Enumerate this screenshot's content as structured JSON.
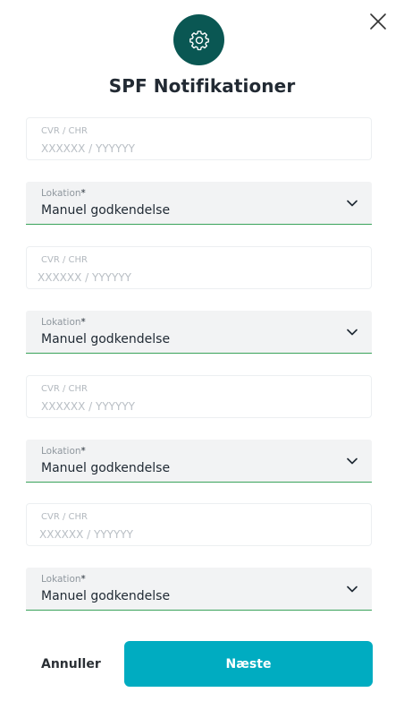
{
  "dialog": {
    "title": "SPF Notifikationer",
    "header_icon": "gear-icon",
    "close_icon": "close-icon"
  },
  "rows": [
    {
      "cvr": {
        "label": "CVR / CHR",
        "placeholder": "XXXXXX / YYYYYY",
        "value": ""
      },
      "location": {
        "label": "Lokation",
        "required_mark": "*",
        "value": "Manuel godkendelse"
      }
    },
    {
      "cvr": {
        "label": "CVR / CHR",
        "placeholder": "XXXXXX / YYYYYY",
        "value": ""
      },
      "location": {
        "label": "Lokation",
        "required_mark": "*",
        "value": "Manuel godkendelse"
      }
    },
    {
      "cvr": {
        "label": "CVR / CHR",
        "placeholder": "XXXXXX / YYYYYY",
        "value": ""
      },
      "location": {
        "label": "Lokation",
        "required_mark": "*",
        "value": "Manuel godkendelse"
      }
    },
    {
      "cvr": {
        "label": "CVR / CHR",
        "placeholder": "XXXXXX / YYYYYY",
        "value": ""
      },
      "location": {
        "label": "Lokation",
        "required_mark": "*",
        "value": "Manuel godkendelse"
      }
    }
  ],
  "footer": {
    "cancel_label": "Annuller",
    "next_label": "Næste"
  },
  "colors": {
    "header_icon_bg": "#0a5753",
    "primary_button": "#00acc1",
    "select_underline": "#3aa35b"
  }
}
